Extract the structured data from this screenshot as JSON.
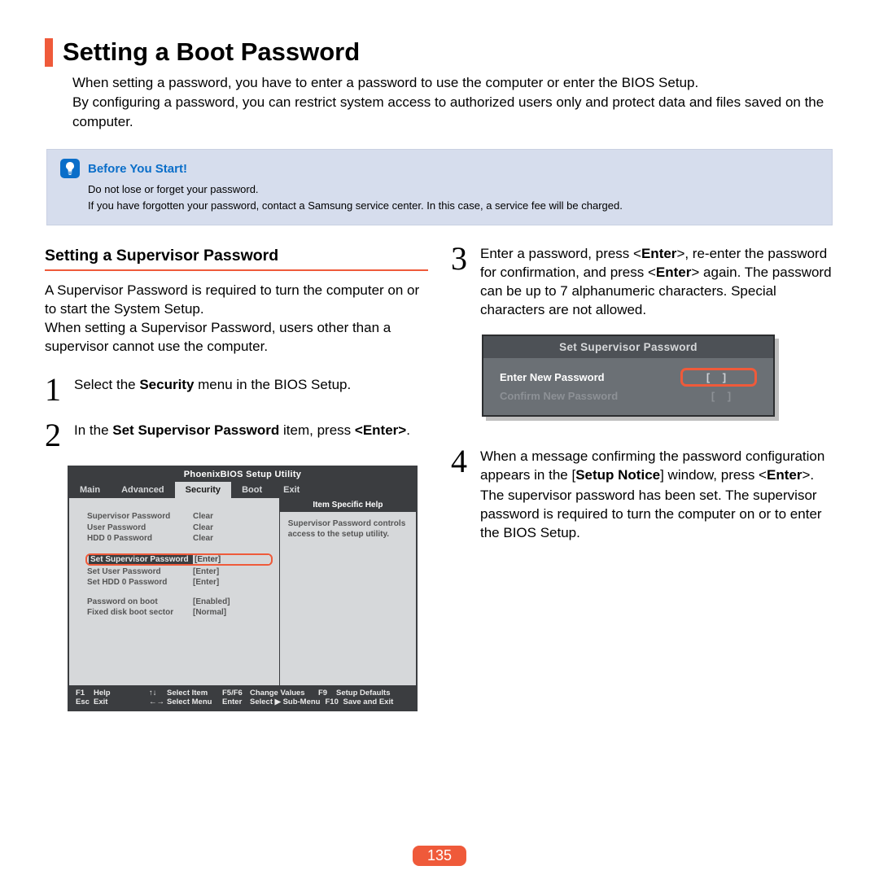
{
  "title": "Setting a Boot Password",
  "intro": "When setting a password, you have to enter a password to use the computer or enter the BIOS Setup.\nBy configuring a password, you can restrict system access to authorized users only and protect data and files saved on the computer.",
  "callout": {
    "title": "Before You Start!",
    "line1": "Do not lose or forget your password.",
    "line2": "If you have forgotten your password, contact a Samsung service center. In this case, a service fee will be charged."
  },
  "section_heading": "Setting a Supervisor Password",
  "section_intro": "A Supervisor Password is required to turn the computer on or to start the System Setup.\nWhen setting a Supervisor Password, users other than a supervisor cannot use the computer.",
  "step1_a": "Select the ",
  "step1_b": "Security",
  "step1_c": " menu in the BIOS Setup.",
  "step2_a": "In the ",
  "step2_b": "Set Supervisor Password",
  "step2_c": " item, press ",
  "step2_d": "<Enter>",
  "step2_e": ".",
  "step3_a": "Enter a password, press <",
  "step3_b": "Enter",
  "step3_c": ">, re-enter the password for confirmation, and press <",
  "step3_d": "Enter",
  "step3_e": "> again. The password can be up to 7 alphanumeric characters. Special characters are not allowed.",
  "step4_a": "When a message confirming the password configuration appears in the [",
  "step4_b": "Setup Notice",
  "step4_c": "] window, press <",
  "step4_d": "Enter",
  "step4_e": ">.",
  "step4_tail": "The supervisor password has been set. The supervisor password is required to turn the computer on or to enter the BIOS Setup.",
  "bios": {
    "title": "PhoenixBIOS Setup Utility",
    "tabs": [
      "Main",
      "Advanced",
      "Security",
      "Boot",
      "Exit"
    ],
    "rows": [
      {
        "lbl": "Supervisor Password",
        "val": "Clear"
      },
      {
        "lbl": "User Password",
        "val": "Clear"
      },
      {
        "lbl": "HDD 0 Password",
        "val": "Clear"
      }
    ],
    "hl": {
      "lbl": "Set Supervisor Password",
      "val": "[Enter]"
    },
    "rows2": [
      {
        "lbl": "Set User Password",
        "val": "[Enter]"
      },
      {
        "lbl": "Set HDD 0 Password",
        "val": "[Enter]"
      }
    ],
    "rows3": [
      {
        "lbl": "Password on boot",
        "val": "[Enabled]"
      },
      {
        "lbl": "Fixed disk boot sector",
        "val": "[Normal]"
      }
    ],
    "help_title": "Item Specific Help",
    "help_body": "Supervisor Password controls access to the setup utility.",
    "footer": {
      "r1": [
        {
          "k": "F1",
          "a": "Help"
        },
        {
          "k": "↑↓",
          "a": "Select Item"
        },
        {
          "k": "F5/F6",
          "a": "Change Values"
        },
        {
          "k": "F9",
          "a": "Setup Defaults"
        }
      ],
      "r2": [
        {
          "k": "Esc",
          "a": "Exit"
        },
        {
          "k": "←→",
          "a": "Select Menu"
        },
        {
          "k": "Enter",
          "a": "Select ▶ Sub-Menu"
        },
        {
          "k": "F10",
          "a": "Save and Exit"
        }
      ]
    }
  },
  "pwd": {
    "title": "Set Supervisor Password",
    "row1": "Enter New Password",
    "row2": "Confirm New Password",
    "field": "[            ]"
  },
  "page": "135"
}
